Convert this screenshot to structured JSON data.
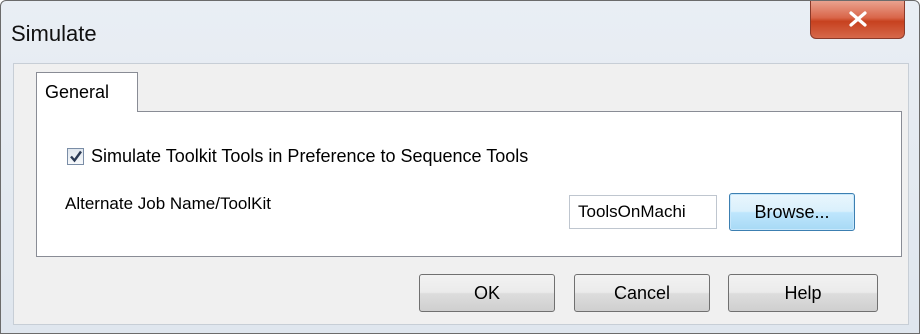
{
  "window": {
    "title": "Simulate"
  },
  "tabs": [
    {
      "label": "General",
      "selected": true
    }
  ],
  "general": {
    "simulate_toolkit": {
      "label": "Simulate Toolkit Tools in Preference to Sequence Tools",
      "checked": true
    },
    "alternate_job": {
      "label": "Alternate Job Name/ToolKit",
      "value": "ToolsOnMachi"
    },
    "browse_label": "Browse..."
  },
  "footer": {
    "ok_label": "OK",
    "cancel_label": "Cancel",
    "help_label": "Help"
  },
  "icons": {
    "close": "close-icon",
    "check": "checkmark-icon"
  }
}
